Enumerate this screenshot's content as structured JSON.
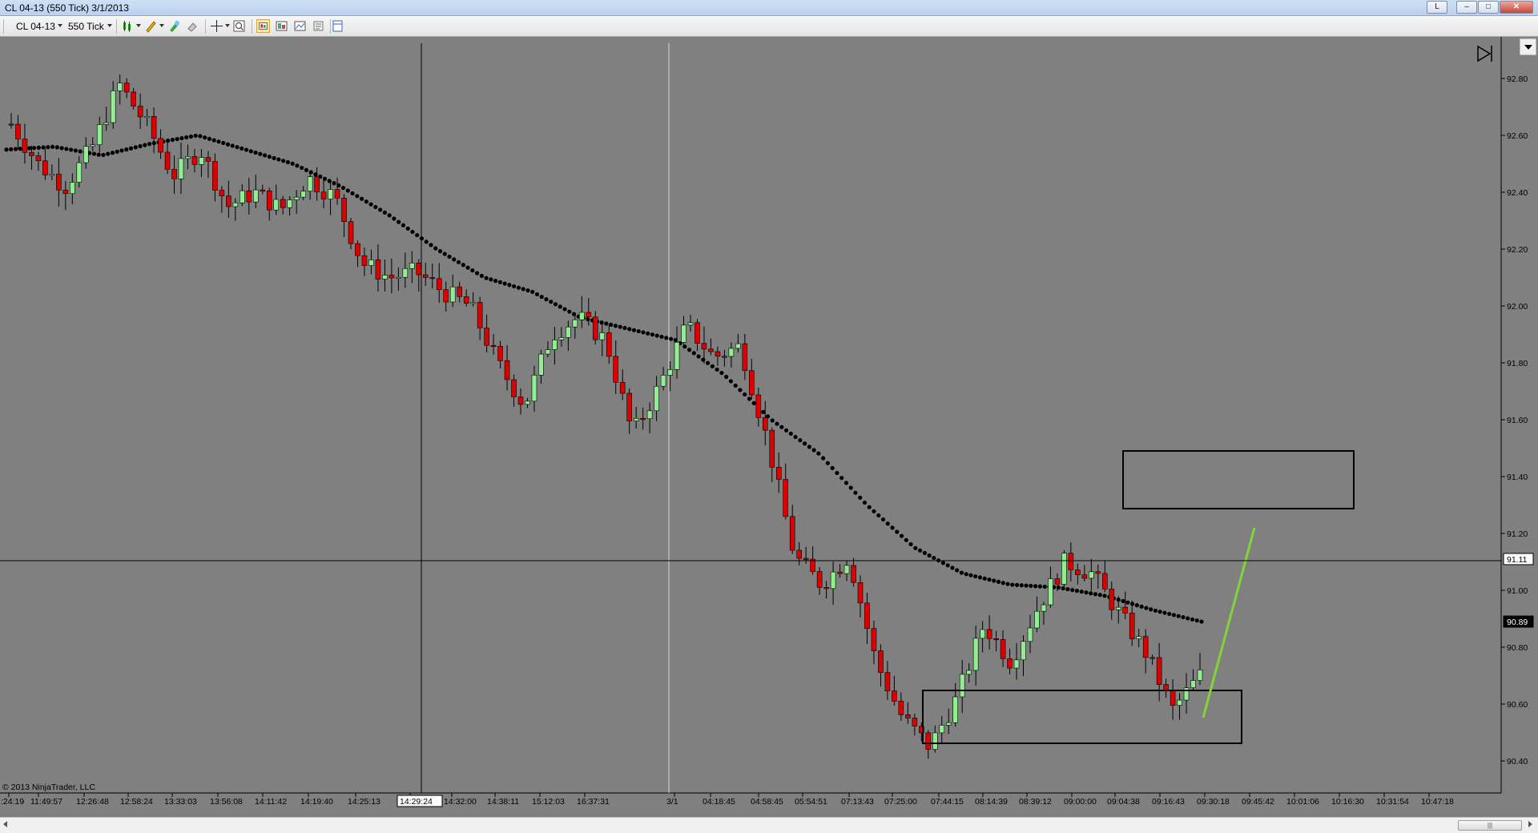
{
  "window": {
    "title": "CL 04-13 (550 Tick)  3/1/2013",
    "buttons": {
      "layout": "L",
      "minimize": "–",
      "maximize": "□",
      "close": "✕"
    }
  },
  "toolbar": {
    "instrument": "CL 04-13",
    "interval": "550 Tick",
    "icons": [
      "bar-type-icon",
      "pencil-draw-icon",
      "marker-icon",
      "eraser-icon",
      "crosshair-icon",
      "zoom-icon",
      "data-box-icon",
      "strategy-icon",
      "indicator-icon",
      "properties-icon",
      "panel-icon"
    ]
  },
  "copyright": "© 2013 NinjaTrader, LLC",
  "colors": {
    "background": "#808080",
    "up": "#90ee90",
    "down": "#dc0000",
    "sma": "#000000",
    "trendline": "#7fd63a",
    "axis": "#000000"
  },
  "chart_data": {
    "type": "candlestick",
    "y_axis": {
      "min": 90.3,
      "max": 92.9,
      "ticks": [
        "92.80",
        "92.60",
        "92.40",
        "92.20",
        "92.00",
        "91.80",
        "91.60",
        "91.40",
        "91.20",
        "91.00",
        "90.80",
        "90.60",
        "90.40"
      ]
    },
    "price_markers": [
      {
        "label": "91.11",
        "value": 91.11,
        "style": "crosshair"
      },
      {
        "label": "90.89",
        "value": 90.89,
        "style": "last"
      }
    ],
    "x_tick_labels": [
      ":24:19",
      "11:49:57",
      "12:26:48",
      "12:58:24",
      "13:33:03",
      "13:56:08",
      "14:11:42",
      "14:19:40",
      "14:25:13",
      "14:29:24",
      "14:32:00",
      "14:38:11",
      "15:12:03",
      "16:37:31",
      "3/1",
      "04:18:45",
      "04:58:45",
      "05:54:51",
      "07:13:43",
      "07:25:00",
      "07:44:15",
      "08:14:39",
      "08:39:12",
      "09:00:00",
      "09:04:38",
      "09:16:43",
      "09:30:18",
      "09:45:42",
      "10:01:06",
      "10:16:30",
      "10:31:54",
      "10:47:18"
    ],
    "crosshair": {
      "x_label": "14:29:24",
      "y_value": 91.11
    },
    "session_break_label": "3/1",
    "close_path": [
      92.64,
      92.5,
      92.42,
      92.56,
      92.78,
      92.64,
      92.46,
      92.55,
      92.35,
      92.4,
      92.34,
      92.45,
      92.38,
      92.15,
      92.1,
      92.12,
      92.05,
      92.0,
      91.8,
      91.65,
      91.9,
      91.96,
      91.88,
      91.55,
      91.72,
      91.93,
      91.82,
      91.86,
      91.52,
      91.12,
      91.02,
      91.12,
      90.75,
      90.55,
      90.45,
      90.62,
      90.88,
      90.75,
      90.94,
      91.1,
      91.06,
      90.92,
      90.78,
      90.58,
      90.7
    ],
    "sma_path": [
      92.55,
      92.56,
      92.53,
      92.57,
      92.6,
      92.55,
      92.5,
      92.42,
      92.32,
      92.2,
      92.1,
      92.05,
      91.96,
      91.92,
      91.88,
      91.76,
      91.6,
      91.48,
      91.3,
      91.15,
      91.06,
      91.02,
      91.01,
      90.98,
      90.93,
      90.89
    ]
  }
}
